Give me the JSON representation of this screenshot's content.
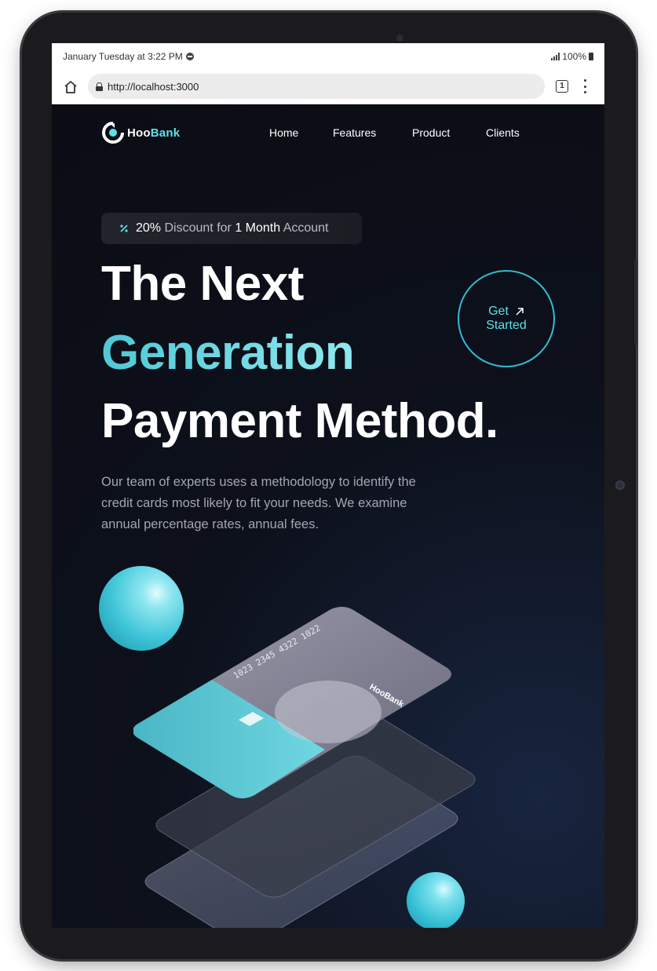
{
  "status_bar": {
    "datetime": "January Tuesday at 3:22 PM",
    "battery": "100%"
  },
  "browser": {
    "url": "http://localhost:3000",
    "tab_count": "1"
  },
  "site": {
    "logo": {
      "part1": "Hoo",
      "part2": "Bank"
    },
    "nav": [
      "Home",
      "Features",
      "Product",
      "Clients"
    ]
  },
  "hero": {
    "promo": {
      "percent": "20%",
      "text1": "Discount",
      "text2": "for",
      "duration": "1 Month",
      "text3": "Account"
    },
    "headline": {
      "line1": "The Next",
      "line2": "Generation",
      "line3": "Payment Method."
    },
    "cta": {
      "line1": "Get",
      "line2": "Started"
    },
    "description": "Our team of experts uses a methodology to identify the credit cards most likely to fit your needs. We examine annual percentage rates, annual fees."
  },
  "card_illustration": {
    "card_number": "1023 2345 4322 1022",
    "card_brand": "HooBank"
  },
  "colors": {
    "accent": "#5ce1e6",
    "background": "#0c0d15",
    "text_muted": "#a3a6b0"
  }
}
